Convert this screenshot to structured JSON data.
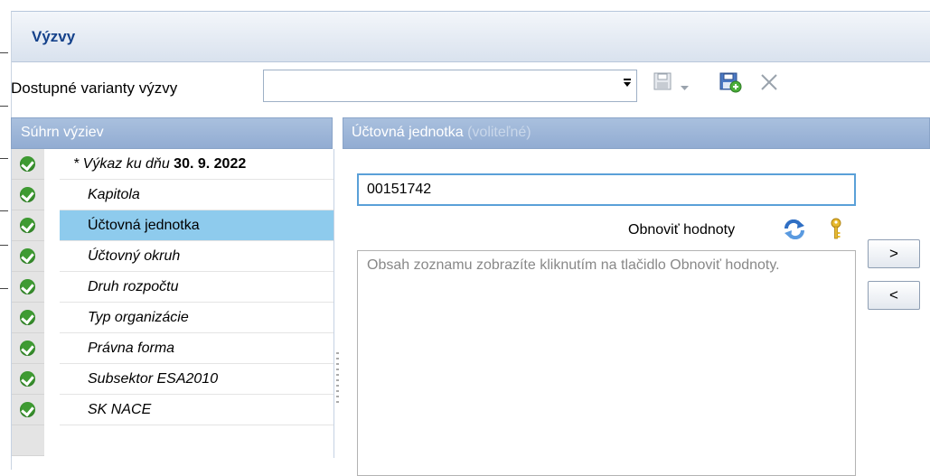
{
  "window": {
    "title": "Výzvy"
  },
  "toolbar": {
    "variant_label": "Dostupné varianty výzvy",
    "variant_value": "",
    "icons": [
      "save-disabled-icon",
      "save-dropdown-icon",
      "save-as-new-icon",
      "delete-icon"
    ]
  },
  "summary": {
    "header": "Súhrn výziev",
    "first_row": {
      "prefix": "* Výkaz ku dňu ",
      "date": "30. 9. 2022"
    },
    "items": [
      {
        "label": "Kapitola",
        "status": "ok"
      },
      {
        "label": "Účtovná jednotka",
        "status": "ok",
        "selected": true
      },
      {
        "label": "Účtovný okruh",
        "status": "ok"
      },
      {
        "label": "Druh rozpočtu",
        "status": "ok"
      },
      {
        "label": "Typ organizácie",
        "status": "ok"
      },
      {
        "label": "Právna forma",
        "status": "ok"
      },
      {
        "label": "Subsektor ESA2010",
        "status": "ok"
      },
      {
        "label": "SK NACE",
        "status": "ok"
      }
    ]
  },
  "detail": {
    "header": "Účtovná jednotka",
    "header_optional": "(voliteľné)",
    "value": "00151742",
    "refresh_label": "Obnoviť hodnoty",
    "list_hint": "Obsah zoznamu zobrazíte kliknutím na tlačidlo Obnoviť hodnoty.",
    "add_button": ">",
    "remove_button": "<"
  },
  "colors": {
    "accent": "#15428b",
    "selection": "#8ecbed",
    "ok": "#3f9b33",
    "header": "#a3bbdb"
  }
}
